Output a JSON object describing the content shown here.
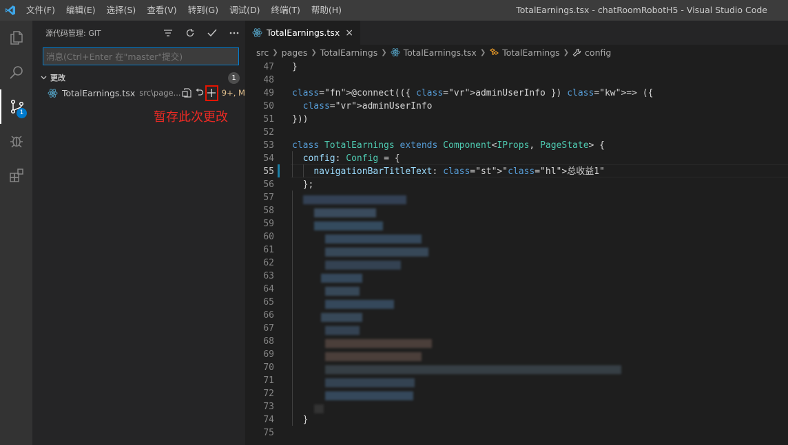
{
  "titlebar": {
    "menu": [
      "文件(F)",
      "编辑(E)",
      "选择(S)",
      "查看(V)",
      "转到(G)",
      "调试(D)",
      "终端(T)",
      "帮助(H)"
    ],
    "window_title": "TotalEarnings.tsx - chatRoomRobotH5 - Visual Studio Code"
  },
  "activitybar": {
    "items": [
      "files-icon",
      "search-icon",
      "source-control-icon",
      "debug-icon",
      "extensions-icon"
    ],
    "scm_badge": "1"
  },
  "scm": {
    "title": "源代码管理: GIT",
    "commit_placeholder": "消息(Ctrl+Enter 在\"master\"提交)",
    "changes_label": "更改",
    "changes_count": "1",
    "file": {
      "name": "TotalEarnings.tsx",
      "path": "src\\page...",
      "status": "9+, M"
    },
    "annotation": "暂存此次更改"
  },
  "editor": {
    "tab_label": "TotalEarnings.tsx",
    "breadcrumbs": [
      "src",
      "pages",
      "TotalEarnings",
      "TotalEarnings.tsx",
      "TotalEarnings",
      "config"
    ],
    "current_line": 55,
    "lines": [
      {
        "n": 47,
        "text": "}"
      },
      {
        "n": 48,
        "text": ""
      },
      {
        "n": 49,
        "text": "@connect(({ adminUserInfo }) => ({"
      },
      {
        "n": 50,
        "text": "  adminUserInfo"
      },
      {
        "n": 51,
        "text": "}))"
      },
      {
        "n": 52,
        "text": ""
      },
      {
        "n": 53,
        "text": "class TotalEarnings extends Component<IProps, PageState> {"
      },
      {
        "n": 54,
        "text": "  config: Config = {"
      },
      {
        "n": 55,
        "text": "    navigationBarTitleText: \"总收益1\""
      },
      {
        "n": 56,
        "text": "  };"
      },
      {
        "n": 57,
        "text": ""
      },
      {
        "n": 58,
        "text": ""
      },
      {
        "n": 59,
        "text": ""
      },
      {
        "n": 60,
        "text": ""
      },
      {
        "n": 61,
        "text": ""
      },
      {
        "n": 62,
        "text": ""
      },
      {
        "n": 63,
        "text": ""
      },
      {
        "n": 64,
        "text": ""
      },
      {
        "n": 65,
        "text": ""
      },
      {
        "n": 66,
        "text": ""
      },
      {
        "n": 67,
        "text": ""
      },
      {
        "n": 68,
        "text": ""
      },
      {
        "n": 69,
        "text": ""
      },
      {
        "n": 70,
        "text": ""
      },
      {
        "n": 71,
        "text": ""
      },
      {
        "n": 72,
        "text": ""
      },
      {
        "n": 73,
        "text": ""
      },
      {
        "n": 74,
        "text": "  }"
      },
      {
        "n": 75,
        "text": ""
      }
    ]
  },
  "colors": {
    "accent": "#007acc",
    "highlight_box": "#e51400",
    "annotation": "#ee2a24",
    "modified": "#e2c08d"
  }
}
